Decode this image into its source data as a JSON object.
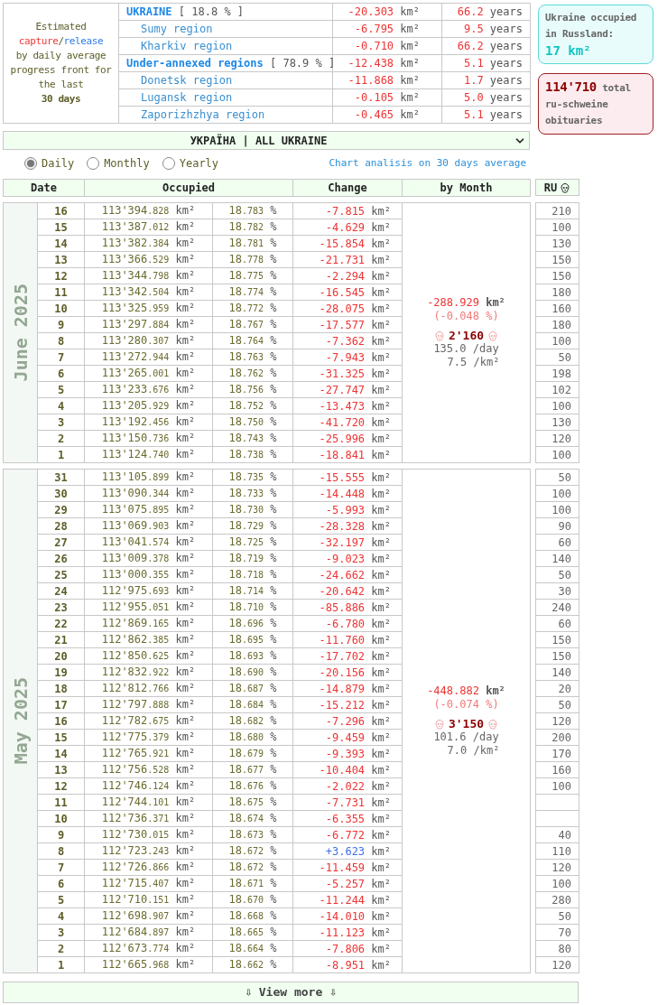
{
  "summary": {
    "caption": {
      "lead": "Estimated",
      "capture": "capture",
      "slash": "/",
      "release": "release",
      "body": "by daily average progress front for the last",
      "period": "30 days"
    },
    "regions": [
      {
        "kind": "total",
        "name": "UKRAINE",
        "share": "[ 18.8 % ]",
        "change": "-20.303 km²",
        "years": "66.2 years"
      },
      {
        "kind": "region",
        "name": "Sumy region",
        "change": "-6.795 km²",
        "years": "9.5 years"
      },
      {
        "kind": "region",
        "name": "Kharkiv region",
        "change": "-0.710 km²",
        "years": "66.2 years"
      },
      {
        "kind": "total",
        "name": "Under-annexed regions",
        "share": "[ 78.9 % ]",
        "change": "-12.438 km²",
        "years": "5.1 years"
      },
      {
        "kind": "region",
        "name": "Donetsk region",
        "change": "-11.868 km²",
        "years": "1.7 years"
      },
      {
        "kind": "region",
        "name": "Lugansk region",
        "change": "-0.105 km²",
        "years": "5.0 years"
      },
      {
        "kind": "region",
        "name": "Zaporizhzhya region",
        "change": "-0.465 km²",
        "years": "5.1 years"
      }
    ]
  },
  "occupied_russia": {
    "label": "Ukraine occupied in Russland:",
    "value": "17 km²"
  },
  "obituaries": {
    "text": "**114'710** total ru-schweine obituaries"
  },
  "region_select": {
    "value": "УКРАЇНА | ALL UKRAINE"
  },
  "period_options": [
    {
      "label": "Daily",
      "selected": true
    },
    {
      "label": "Monthly",
      "selected": false
    },
    {
      "label": "Yearly",
      "selected": false
    }
  ],
  "chart_link": "Chart analisis on 30 days average",
  "table": {
    "columns": [
      "Date",
      "Occupied",
      "Change",
      "by Month"
    ],
    "ru_column": "RU",
    "months": [
      {
        "label": "June 2025",
        "summary": {
          "change": "-288.929 km²",
          "change_pct": "(-0.048 %)",
          "deaths": "2'160",
          "per_day": "135.0 /day",
          "per_km": "7.5 /km²"
        },
        "rows": [
          {
            "date": "16",
            "occupied": "113'394.828 km²",
            "share": "18.783 %",
            "change": "-7.815 km²",
            "gain": false,
            "ru": "210"
          },
          {
            "date": "15",
            "occupied": "113'387.012 km²",
            "share": "18.782 %",
            "change": "-4.629 km²",
            "gain": false,
            "ru": "100"
          },
          {
            "date": "14",
            "occupied": "113'382.384 km²",
            "share": "18.781 %",
            "change": "-15.854 km²",
            "gain": false,
            "ru": "130"
          },
          {
            "date": "13",
            "occupied": "113'366.529 km²",
            "share": "18.778 %",
            "change": "-21.731 km²",
            "gain": false,
            "ru": "150"
          },
          {
            "date": "12",
            "occupied": "113'344.798 km²",
            "share": "18.775 %",
            "change": "-2.294 km²",
            "gain": false,
            "ru": "150"
          },
          {
            "date": "11",
            "occupied": "113'342.504 km²",
            "share": "18.774 %",
            "change": "-16.545 km²",
            "gain": false,
            "ru": "180"
          },
          {
            "date": "10",
            "occupied": "113'325.959 km²",
            "share": "18.772 %",
            "change": "-28.075 km²",
            "gain": false,
            "ru": "160"
          },
          {
            "date": "9",
            "occupied": "113'297.884 km²",
            "share": "18.767 %",
            "change": "-17.577 km²",
            "gain": false,
            "ru": "180"
          },
          {
            "date": "8",
            "occupied": "113'280.307 km²",
            "share": "18.764 %",
            "change": "-7.362 km²",
            "gain": false,
            "ru": "100"
          },
          {
            "date": "7",
            "occupied": "113'272.944 km²",
            "share": "18.763 %",
            "change": "-7.943 km²",
            "gain": false,
            "ru": "50"
          },
          {
            "date": "6",
            "occupied": "113'265.001 km²",
            "share": "18.762 %",
            "change": "-31.325 km²",
            "gain": false,
            "ru": "198"
          },
          {
            "date": "5",
            "occupied": "113'233.676 km²",
            "share": "18.756 %",
            "change": "-27.747 km²",
            "gain": false,
            "ru": "102"
          },
          {
            "date": "4",
            "occupied": "113'205.929 km²",
            "share": "18.752 %",
            "change": "-13.473 km²",
            "gain": false,
            "ru": "100"
          },
          {
            "date": "3",
            "occupied": "113'192.456 km²",
            "share": "18.750 %",
            "change": "-41.720 km²",
            "gain": false,
            "ru": "130"
          },
          {
            "date": "2",
            "occupied": "113'150.736 km²",
            "share": "18.743 %",
            "change": "-25.996 km²",
            "gain": false,
            "ru": "120"
          },
          {
            "date": "1",
            "occupied": "113'124.740 km²",
            "share": "18.738 %",
            "change": "-18.841 km²",
            "gain": false,
            "ru": "100"
          }
        ]
      },
      {
        "label": "May 2025",
        "summary": {
          "change": "-448.882 km²",
          "change_pct": "(-0.074 %)",
          "deaths": "3'150",
          "per_day": "101.6 /day",
          "per_km": "7.0 /km²"
        },
        "rows": [
          {
            "date": "31",
            "occupied": "113'105.899 km²",
            "share": "18.735 %",
            "change": "-15.555 km²",
            "gain": false,
            "ru": "50"
          },
          {
            "date": "30",
            "occupied": "113'090.344 km²",
            "share": "18.733 %",
            "change": "-14.448 km²",
            "gain": false,
            "ru": "100"
          },
          {
            "date": "29",
            "occupied": "113'075.895 km²",
            "share": "18.730 %",
            "change": "-5.993 km²",
            "gain": false,
            "ru": "100"
          },
          {
            "date": "28",
            "occupied": "113'069.903 km²",
            "share": "18.729 %",
            "change": "-28.328 km²",
            "gain": false,
            "ru": "90"
          },
          {
            "date": "27",
            "occupied": "113'041.574 km²",
            "share": "18.725 %",
            "change": "-32.197 km²",
            "gain": false,
            "ru": "60"
          },
          {
            "date": "26",
            "occupied": "113'009.378 km²",
            "share": "18.719 %",
            "change": "-9.023 km²",
            "gain": false,
            "ru": "140"
          },
          {
            "date": "25",
            "occupied": "113'000.355 km²",
            "share": "18.718 %",
            "change": "-24.662 km²",
            "gain": false,
            "ru": "50"
          },
          {
            "date": "24",
            "occupied": "112'975.693 km²",
            "share": "18.714 %",
            "change": "-20.642 km²",
            "gain": false,
            "ru": "30"
          },
          {
            "date": "23",
            "occupied": "112'955.051 km²",
            "share": "18.710 %",
            "change": "-85.886 km²",
            "gain": false,
            "ru": "240"
          },
          {
            "date": "22",
            "occupied": "112'869.165 km²",
            "share": "18.696 %",
            "change": "-6.780 km²",
            "gain": false,
            "ru": "60"
          },
          {
            "date": "21",
            "occupied": "112'862.385 km²",
            "share": "18.695 %",
            "change": "-11.760 km²",
            "gain": false,
            "ru": "150"
          },
          {
            "date": "20",
            "occupied": "112'850.625 km²",
            "share": "18.693 %",
            "change": "-17.702 km²",
            "gain": false,
            "ru": "150"
          },
          {
            "date": "19",
            "occupied": "112'832.922 km²",
            "share": "18.690 %",
            "change": "-20.156 km²",
            "gain": false,
            "ru": "140"
          },
          {
            "date": "18",
            "occupied": "112'812.766 km²",
            "share": "18.687 %",
            "change": "-14.879 km²",
            "gain": false,
            "ru": "20"
          },
          {
            "date": "17",
            "occupied": "112'797.888 km²",
            "share": "18.684 %",
            "change": "-15.212 km²",
            "gain": false,
            "ru": "50"
          },
          {
            "date": "16",
            "occupied": "112'782.675 km²",
            "share": "18.682 %",
            "change": "-7.296 km²",
            "gain": false,
            "ru": "120"
          },
          {
            "date": "15",
            "occupied": "112'775.379 km²",
            "share": "18.680 %",
            "change": "-9.459 km²",
            "gain": false,
            "ru": "200"
          },
          {
            "date": "14",
            "occupied": "112'765.921 km²",
            "share": "18.679 %",
            "change": "-9.393 km²",
            "gain": false,
            "ru": "170"
          },
          {
            "date": "13",
            "occupied": "112'756.528 km²",
            "share": "18.677 %",
            "change": "-10.404 km²",
            "gain": false,
            "ru": "160"
          },
          {
            "date": "12",
            "occupied": "112'746.124 km²",
            "share": "18.676 %",
            "change": "-2.022 km²",
            "gain": false,
            "ru": "100"
          },
          {
            "date": "11",
            "occupied": "112'744.101 km²",
            "share": "18.675 %",
            "change": "-7.731 km²",
            "gain": false
          },
          {
            "date": "10",
            "occupied": "112'736.371 km²",
            "share": "18.674 %",
            "change": "-6.355 km²",
            "gain": false
          },
          {
            "date": "9",
            "occupied": "112'730.015 km²",
            "share": "18.673 %",
            "change": "-6.772 km²",
            "gain": false,
            "ru": "40"
          },
          {
            "date": "8",
            "occupied": "112'723.243 km²",
            "share": "18.672 %",
            "change": "+3.623 km²",
            "gain": true,
            "ru": "110"
          },
          {
            "date": "7",
            "occupied": "112'726.866 km²",
            "share": "18.672 %",
            "change": "-11.459 km²",
            "gain": false,
            "ru": "120"
          },
          {
            "date": "6",
            "occupied": "112'715.407 km²",
            "share": "18.671 %",
            "change": "-5.257 km²",
            "gain": false,
            "ru": "100"
          },
          {
            "date": "5",
            "occupied": "112'710.151 km²",
            "share": "18.670 %",
            "change": "-11.244 km²",
            "gain": false,
            "ru": "280"
          },
          {
            "date": "4",
            "occupied": "112'698.907 km²",
            "share": "18.668 %",
            "change": "-14.010 km²",
            "gain": false,
            "ru": "50"
          },
          {
            "date": "3",
            "occupied": "112'684.897 km²",
            "share": "18.665 %",
            "change": "-11.123 km²",
            "gain": false,
            "ru": "70"
          },
          {
            "date": "2",
            "occupied": "112'673.774 km²",
            "share": "18.664 %",
            "change": "-7.806 km²",
            "gain": false,
            "ru": "80"
          },
          {
            "date": "1",
            "occupied": "112'665.968 km²",
            "share": "18.662 %",
            "change": "-8.951 km²",
            "gain": false,
            "ru": "120"
          }
        ]
      }
    ]
  },
  "view_more": "⇩ View more ⇩"
}
